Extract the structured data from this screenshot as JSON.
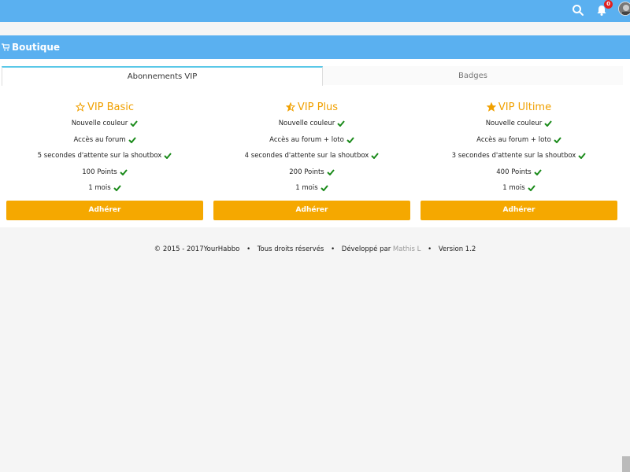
{
  "topbar": {
    "notification_count": "0",
    "bg_color": "#5ab0f0"
  },
  "section": {
    "title": "Boutique",
    "icon": "cart-icon"
  },
  "tabs": [
    {
      "label": "Abonnements VIP",
      "active": true
    },
    {
      "label": "Badges",
      "active": false
    }
  ],
  "plans": [
    {
      "title": "VIP Basic",
      "icon": "star-outline-icon",
      "features": [
        "Nouvelle couleur",
        "Accès au forum",
        "5 secondes d'attente sur la shoutbox",
        "100 Points",
        "1 mois"
      ],
      "button": "Adhérer"
    },
    {
      "title": "VIP Plus",
      "icon": "star-half-icon",
      "features": [
        "Nouvelle couleur",
        "Accès au forum + loto",
        "4 secondes d'attente sur la shoutbox",
        "200 Points",
        "1 mois"
      ],
      "button": "Adhérer"
    },
    {
      "title": "VIP Ultime",
      "icon": "star-full-icon",
      "features": [
        "Nouvelle couleur",
        "Accès au forum + loto",
        "3 secondes d'attente sur la shoutbox",
        "400 Points",
        "1 mois"
      ],
      "button": "Adhérer"
    }
  ],
  "footer": {
    "copyright": "© 2015 - 2017YourHabbo",
    "rights": "Tous droits réservés",
    "developed_by": "Développé par",
    "developer": "Mathis L",
    "version": "Version 1.2"
  },
  "colors": {
    "accent": "#f5a800",
    "header": "#5ab0f0",
    "check": "#1a8a1a"
  }
}
